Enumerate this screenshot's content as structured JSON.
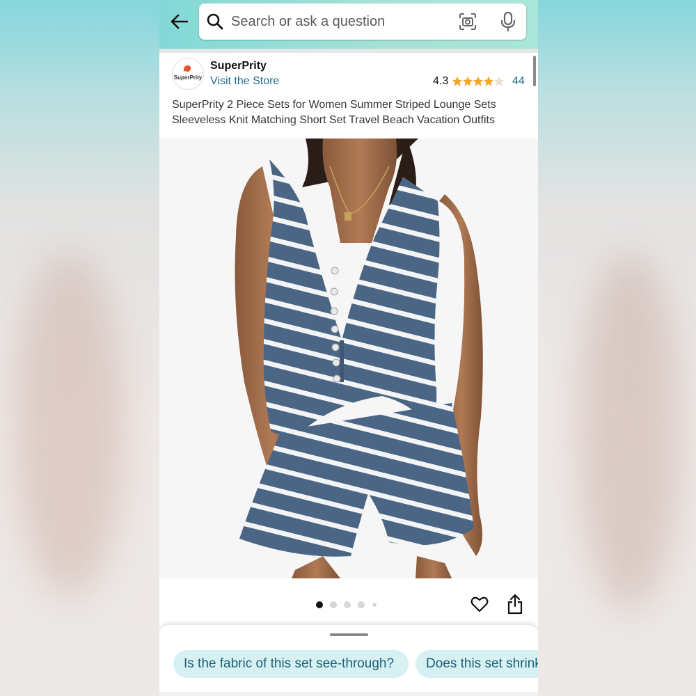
{
  "search": {
    "placeholder": "Search or ask a question"
  },
  "icons": {
    "back": "arrow-left-icon",
    "search": "search-icon",
    "camera": "camera-scan-icon",
    "mic": "microphone-icon",
    "favorite": "heart-icon",
    "share": "share-icon"
  },
  "seller": {
    "logo_text": "SuperPrity",
    "name": "SuperPrity",
    "visit_store": "Visit the Store",
    "rating": "4.3",
    "rating_stars": 4.3,
    "review_count": "44"
  },
  "product": {
    "title": "SuperPrity 2 Piece Sets for Women Summer Striped Lounge Sets Sleeveless Knit Matching Short Set Travel Beach Vacation Outfits",
    "image_count": 5,
    "current_image": 1
  },
  "questions": [
    "Is the fabric of this set see-through?",
    "Does this set shrink"
  ],
  "colors": {
    "header_teal": "#8fdcd6",
    "link": "#1f6f8b",
    "chip_bg": "#d7f1f3",
    "star": "#f5a623",
    "outfit_navy": "#4a6582"
  }
}
